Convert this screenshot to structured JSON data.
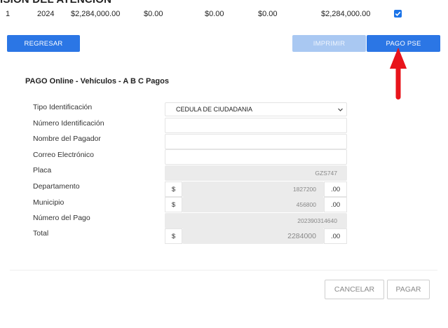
{
  "page_heading": "ISIÓN DEL ATENCIÓN",
  "table_row": {
    "index": "1",
    "year": "2024",
    "amount1": "$2,284,000.00",
    "amount2": "$0.00",
    "amount3": "$0.00",
    "amount4": "$0.00",
    "total": "$2,284,000.00",
    "checked": true
  },
  "actions": {
    "back_label": "REGRESAR",
    "print_label": "IMPRIMIR",
    "pse_label": "PAGO PSE"
  },
  "form": {
    "title": "PAGO Online - Vehículos - A B C Pagos",
    "labels": {
      "id_type": "Tipo Identificación",
      "id_number": "Número Identificación",
      "payer_name": "Nombre del Pagador",
      "email": "Correo Electrónico",
      "plate": "Placa",
      "department": "Departamento",
      "municipality": "Municipio",
      "payment_number": "Número del Pago",
      "total": "Total"
    },
    "values": {
      "id_type": "CEDULA DE CIUDADANIA",
      "id_number": "",
      "payer_name": "",
      "email": "",
      "plate": "GZS747",
      "department": "1827200",
      "municipality": "456800",
      "payment_number": "202390314640",
      "total": "2284000"
    },
    "currency_symbol": "$",
    "cents": ".00"
  },
  "footer": {
    "cancel_label": "CANCELAR",
    "pay_label": "PAGAR"
  },
  "colors": {
    "primary": "#2b76e5",
    "primary_disabled": "#a9c8f2",
    "annotation_arrow": "#e8141b"
  }
}
